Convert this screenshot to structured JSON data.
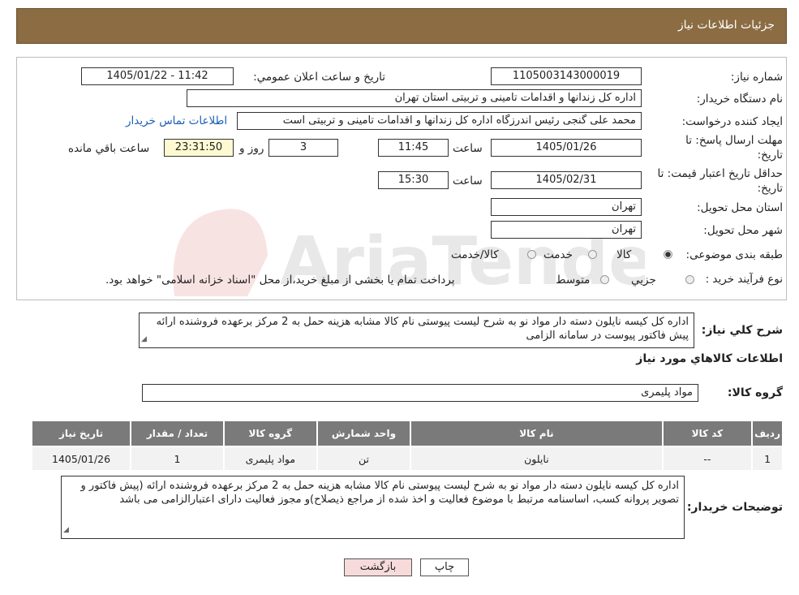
{
  "header": {
    "title": "جزئیات اطلاعات نیاز"
  },
  "watermark": {
    "text": "AriaTender.neT"
  },
  "form": {
    "need_number_label": "شماره نیاز:",
    "need_number": "1105003143000019",
    "announce_label": "تاریخ و ساعت اعلان عمومي:",
    "announce_value": "1405/01/22 - 11:42",
    "buyer_org_label": "نام دستگاه خریدار:",
    "buyer_org": "اداره کل زندانها و اقدامات تامینی و تربیتی استان تهران",
    "creator_label": "ایجاد کننده درخواست:",
    "creator": "محمد علی گنجی رئیس اندرزگاه  اداره کل زندانها و اقدامات تامینی و تربیتی است",
    "contact_link": "اطلاعات تماس خریدار",
    "deadline_label_1": "مهلت ارسال پاسخ: تا",
    "deadline_label_2": "تاریخ:",
    "deadline_date": "1405/01/26",
    "time_label": "ساعت",
    "deadline_time": "11:45",
    "days_value": "3",
    "days_label": "روز و",
    "remaining_value": "23:31:50",
    "remaining_label": "ساعت باقي مانده",
    "validity_label_1": "حداقل تاریخ اعتبار قیمت: تا",
    "validity_label_2": "تاریخ:",
    "validity_date": "1405/02/31",
    "validity_time": "15:30",
    "province_label": "استان محل تحویل:",
    "province": "تهران",
    "city_label": "شهر محل تحویل:",
    "city": "تهران",
    "category_label": "طبقه بندی موضوعی:",
    "category_options": [
      "کالا",
      "خدمت",
      "کالا/خدمت"
    ],
    "category_selected": "کالا",
    "purchase_type_label": "نوع فرآیند خرید :",
    "purchase_options": [
      "جزیي",
      "متوسط"
    ],
    "purchase_note": "پرداخت تمام یا بخشی از مبلغ خرید،از محل \"اسناد خزانه اسلامی\" خواهد بود."
  },
  "description": {
    "label": "شرح کلي نیاز:",
    "text": "اداره کل کیسه نایلون دسته دار مواد نو به شرح لیست پیوستی نام کالا مشابه هزینه حمل به 2 مرکز برعهده فروشنده ارائه پیش فاکتور  پیوست در سامانه الزامی"
  },
  "goods": {
    "section_title": "اطلاعات کالاهاي مورد نیاز",
    "group_label": "گروه کالا:",
    "group_value": "مواد پلیمری",
    "table": {
      "headers": [
        "ردیف",
        "کد کالا",
        "نام کالا",
        "واحد شمارش",
        "گروه کالا",
        "تعداد / مقدار",
        "تاریخ نیاز"
      ],
      "rows": [
        [
          "1",
          "--",
          "نایلون",
          "تن",
          "مواد پلیمری",
          "1",
          "1405/01/26"
        ]
      ]
    }
  },
  "buyer_notes": {
    "label": "توضیحات خریدار:",
    "text": "اداره کل کیسه نایلون دسته دار مواد نو به شرح لیست پیوستی نام کالا مشابه هزینه حمل  به 2 مرکز برعهده فروشنده ارائه (پیش فاکتور و  تصویر پروانه کسب، اساسنامه مرتبط با موضوع فعالیت و اخذ شده از مراجع ذیصلاح)و مجوز فعالیت دارای اعتبارالزامی می باشد"
  },
  "buttons": {
    "print": "چاپ",
    "back": "بازگشت"
  },
  "colors": {
    "header_bg": "#8b6c43",
    "table_header_bg": "#7a7a7a",
    "remaining_bg": "#fdfad2",
    "back_btn_bg": "#f7dada",
    "print_btn_bg": "#ffffff"
  }
}
